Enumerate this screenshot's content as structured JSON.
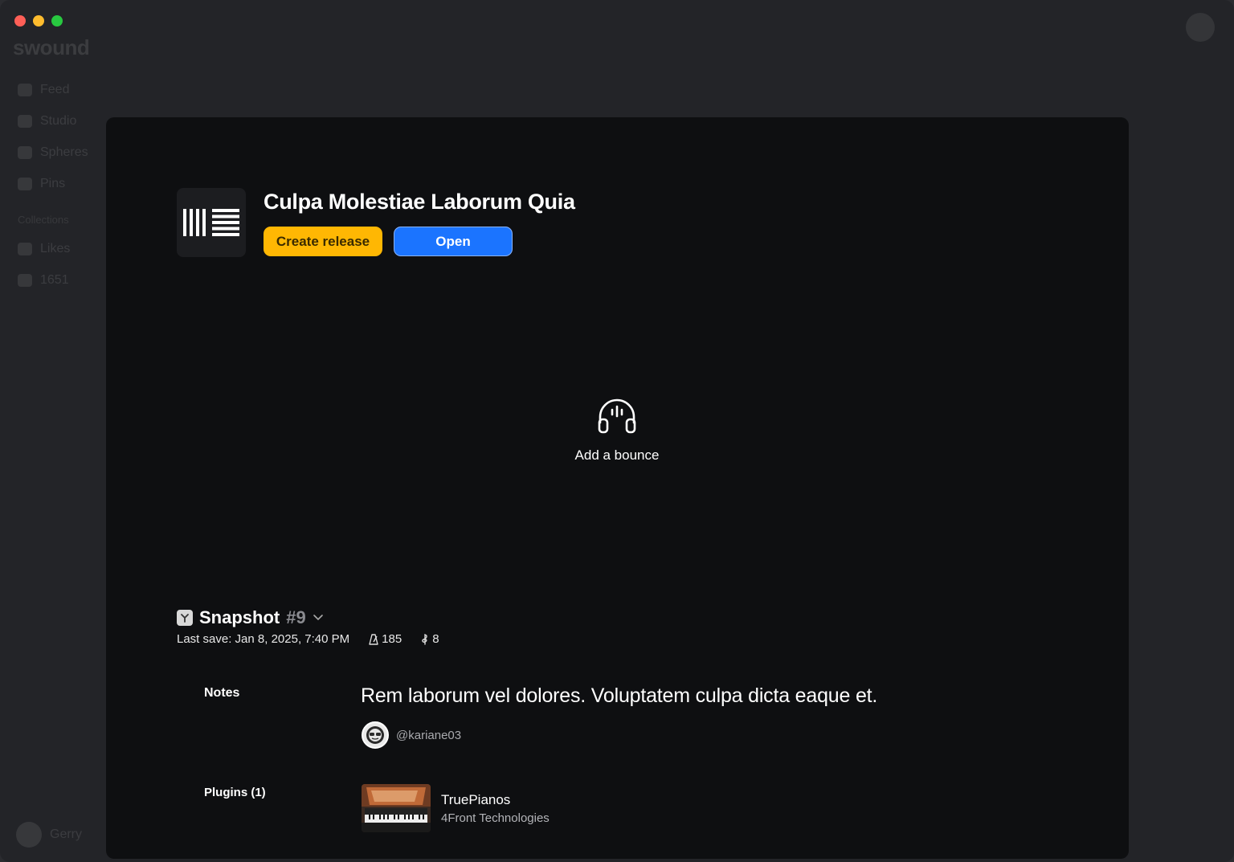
{
  "app": {
    "brand": "swound"
  },
  "sidebar": {
    "items": [
      {
        "label": "Feed"
      },
      {
        "label": "Studio"
      },
      {
        "label": "Spheres"
      },
      {
        "label": "Pins"
      }
    ],
    "collections_label": "Collections",
    "collections": [
      {
        "label": "Likes"
      },
      {
        "label": "1651"
      }
    ],
    "user": "Gerry"
  },
  "project": {
    "title": "Culpa Molestiae Laborum Quia",
    "create_release_label": "Create release",
    "open_label": "Open"
  },
  "bounce": {
    "label": "Add a bounce"
  },
  "snapshot": {
    "title": "Snapshot",
    "number": "#9",
    "last_save_label": "Last save:",
    "last_save_value": "Jan 8, 2025, 7:40 PM",
    "tempo": "185",
    "key": "8"
  },
  "notes": {
    "label": "Notes",
    "text": "Rem laborum vel dolores. Voluptatem culpa dicta eaque et.",
    "author": "@kariane03"
  },
  "plugins": {
    "label": "Plugins (1)",
    "items": [
      {
        "name": "TruePianos",
        "vendor": "4Front Technologies"
      }
    ]
  },
  "colors": {
    "release_button": "#ffb703",
    "open_button": "#1b74ff",
    "modal_bg": "#0e0f11"
  }
}
